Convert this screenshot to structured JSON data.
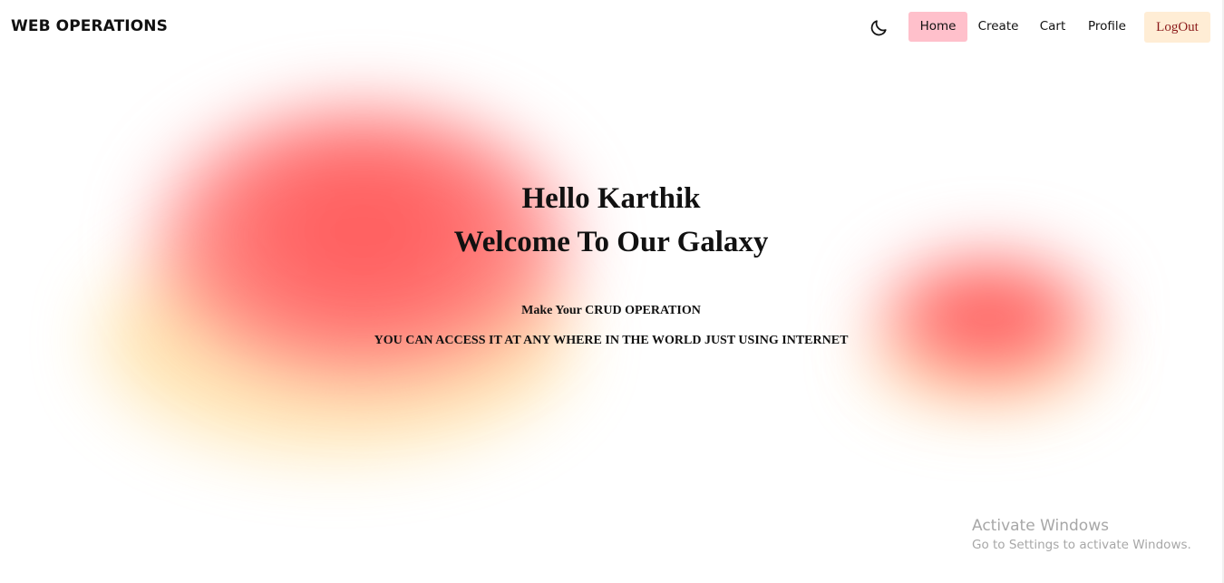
{
  "header": {
    "brand": "WEB OPERATIONS",
    "theme_toggle_icon": "moon-icon",
    "nav": {
      "home": "Home",
      "create": "Create",
      "cart": "Cart",
      "profile": "Profile",
      "logout": "LogOut"
    },
    "active_nav": "Home"
  },
  "hero": {
    "greeting": "Hello Karthik",
    "welcome": "Welcome To Our Galaxy",
    "tagline": "Make Your CRUD OPERATION",
    "description": "YOU CAN ACCESS IT AT ANY WHERE IN THE WORLD JUST USING INTERNET"
  },
  "watermark": {
    "title": "Activate Windows",
    "subtitle": "Go to Settings to activate Windows."
  },
  "colors": {
    "active_nav_bg": "#ffc0cb",
    "logout_bg": "#ffedd5",
    "logout_text": "#8b1a1a",
    "blob_red": "#ff5a5a",
    "blob_yellow": "#ffd37a"
  }
}
